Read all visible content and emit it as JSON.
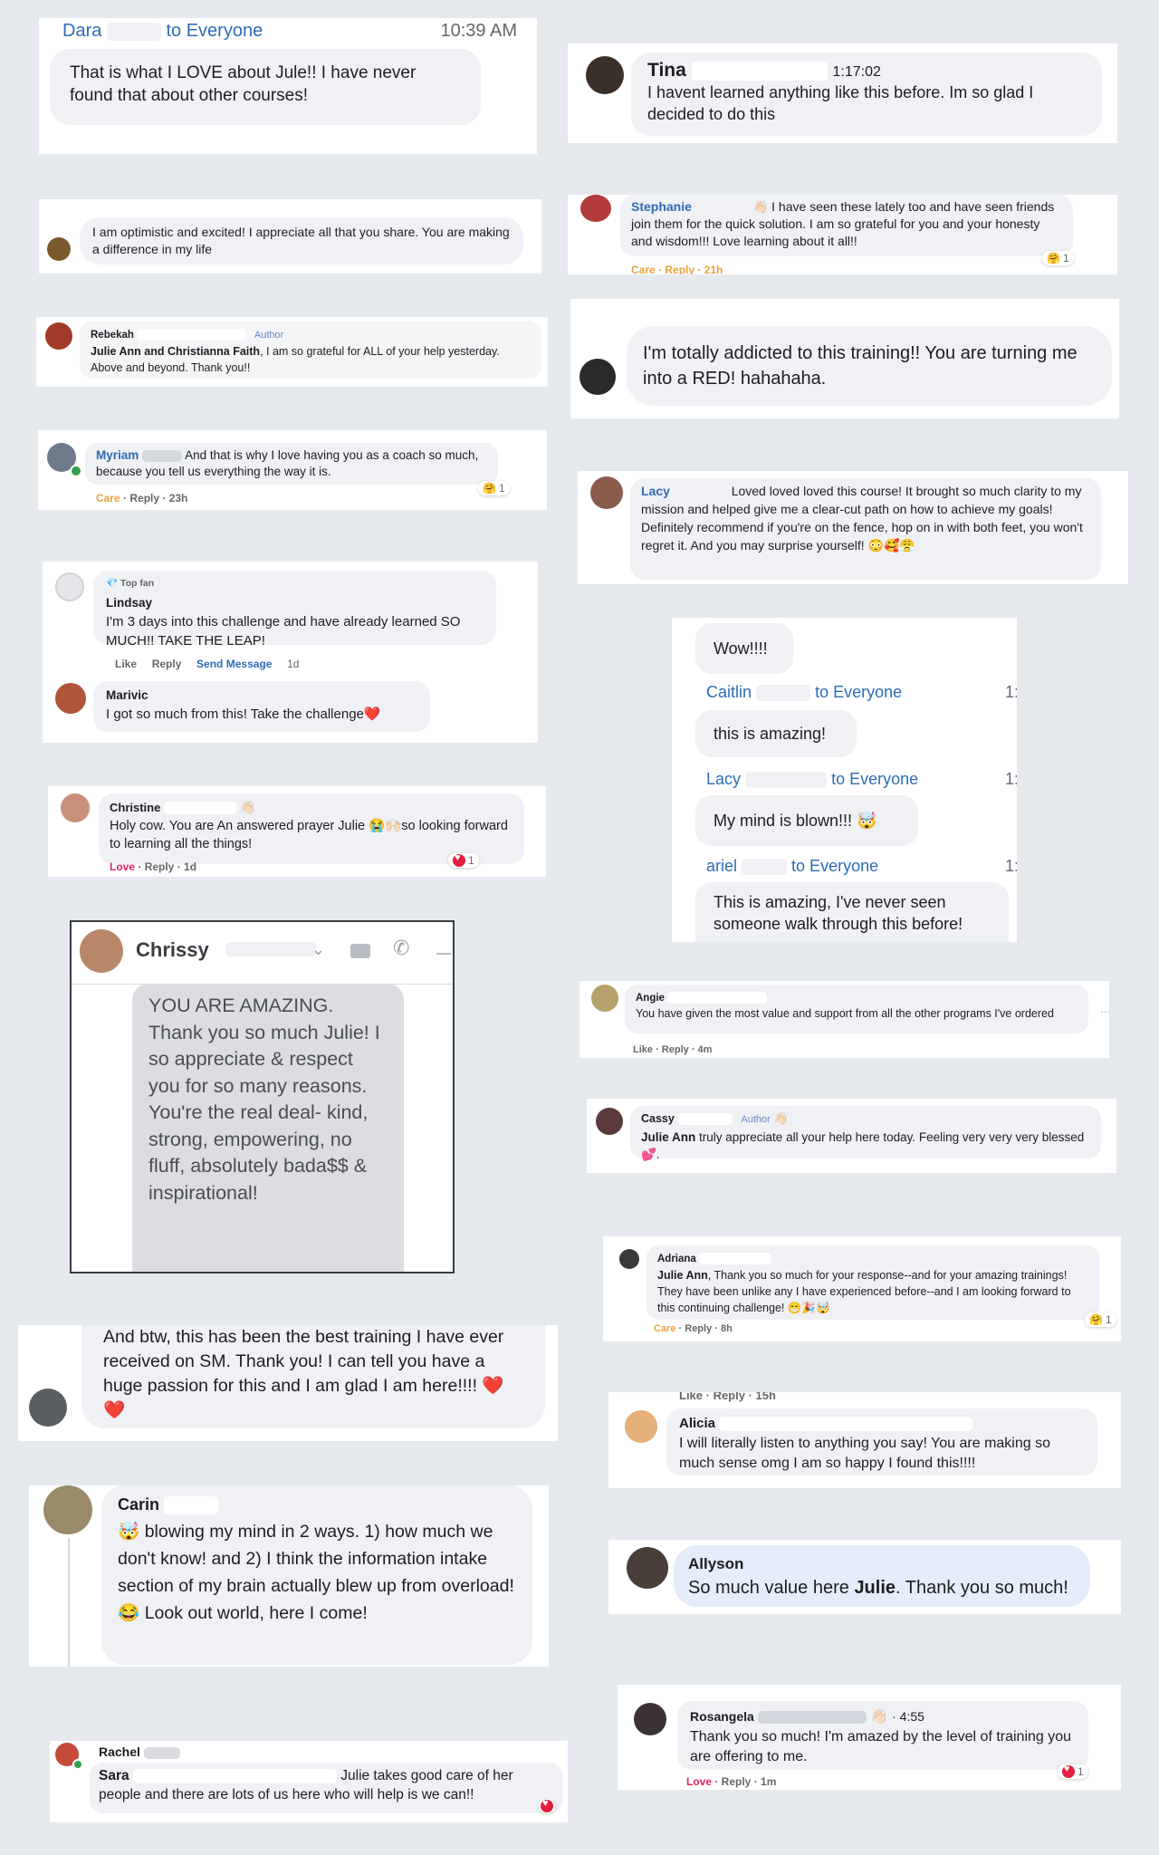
{
  "c1": {
    "name": "Dara",
    "to": "to Everyone",
    "time": "10:39 AM",
    "text": "That is what I LOVE about Jule!! I have never found that about other courses!"
  },
  "c2": {
    "name": "Tina",
    "time": "1:17:02",
    "text": "I havent learned anything like this before. Im so glad I decided to do this"
  },
  "c3": {
    "text": "I am optimistic and excited! I appreciate all that you share. You are making a difference in my life"
  },
  "c4": {
    "name": "Stephanie",
    "text": "I have seen these lately too and have seen friends join them for the quick solution. I am so grateful for you and your honesty and wisdom!!! Love learning about it all!!",
    "meta": "Care · Reply · 21h",
    "react_count": "1"
  },
  "c5": {
    "name": "Rebekah",
    "badge": "Author",
    "mention": "Julie Ann and Christianna Faith",
    "text": ", I am so grateful for ALL of your help yesterday. Above and beyond. Thank you!!"
  },
  "c6": {
    "text": "I'm totally addicted to this training!! You are turning me into a RED! hahahaha."
  },
  "c7": {
    "name": "Myriam",
    "text": "And that is why I love having you as a coach so much, because you tell us everything the way it is.",
    "meta_react": "Care",
    "meta_rest": " · Reply · 23h",
    "react_count": "1"
  },
  "c8": {
    "name": "Lacy",
    "text": "Loved loved loved this course! It brought so much clarity to my mission and helped give me a clear-cut path on how to achieve my goals! Definitely recommend if you're on the fence, hop on in with both feet, you won't regret it. And you may surprise yourself! 😳🥰😤"
  },
  "c9": {
    "badge": "Top fan",
    "name1": "Lindsay",
    "text1": "I'm 3 days into this challenge and have already learned SO MUCH!! TAKE THE LEAP!",
    "like": "Like",
    "reply": "Reply",
    "send": "Send Message",
    "age": "1d",
    "name2": "Marivic",
    "text2": "I got so much from this! Take the challenge❤️"
  },
  "c10": {
    "bubble1": "Wow!!!!",
    "name2": "Caitlin",
    "to2": "to Everyone",
    "bubble2": "this is amazing!",
    "name3": "Lacy",
    "to3": "to Everyone",
    "bubble3": "My mind is blown!!! 🤯",
    "name4": "ariel",
    "to4": "to Everyone",
    "bubble4": "This is amazing, I've never seen someone walk through this before!",
    "time_stub": "1:"
  },
  "c11": {
    "name": "Christine",
    "text": "Holy cow. You are An answered prayer Julie 😭🙌🏻so looking forward to learning all the things!",
    "meta_react": "Love",
    "meta_rest": " · Reply · 1d",
    "react_count": "1"
  },
  "c12": {
    "name": "Chrissy",
    "text": "YOU ARE AMAZING. Thank you so much Julie! I so appreciate & respect you for so many reasons. You're the real deal- kind, strong, empowering, no fluff, absolutely bada$$ & inspirational!"
  },
  "c13": {
    "name": "Angie",
    "text": "You have given the most value and support from all the other programs I've ordered",
    "meta": "Like · Reply · 4m"
  },
  "c14": {
    "name": "Cassy",
    "badge": "Author",
    "mention": "Julie Ann",
    "text": " truly appreciate all your help here today. Feeling very very very blessed💕."
  },
  "c15": {
    "text": "And btw, this has been the best training I have ever received on SM. Thank you! I can tell you have a huge passion for this and I am glad I am here!!!! ❤️❤️"
  },
  "c16": {
    "name": "Adriana",
    "mention": "Julie Ann",
    "text": ", Thank you so much for your response--and for your amazing trainings! They have been unlike any I have experienced before--and I am looking forward to this continuing challenge! 😁🎉🤯",
    "meta_react": "Care",
    "meta_rest": " · Reply · 8h",
    "react_count": "1"
  },
  "c17": {
    "top_meta": "Like · Reply · 15h",
    "name": "Alicia",
    "text": "I will literally listen to anything you say! You are making so much sense omg I am so happy I found this!!!!"
  },
  "c18": {
    "name": "Carin",
    "text": "🤯 blowing my mind in 2 ways. 1) how much we don't know! and 2) I think the information intake section of my brain actually blew up from overload! 😂 Look out world, here I come!"
  },
  "c19": {
    "name": "Allyson",
    "text_a": "So much value here ",
    "text_b": "Julie",
    "text_c": ". Thank you so much!"
  },
  "c20": {
    "name": "Rosangela",
    "time": "4:55",
    "text": "Thank you so much! I'm amazed by the level of training you are offering to me.",
    "meta_react": "Love",
    "meta_rest": " · Reply · 1m",
    "react_count": "1"
  },
  "c21": {
    "name": "Rachel",
    "sub_name": "Sara",
    "text": "Julie takes good care of her people and there are lots of us here who will help is we can!!"
  }
}
